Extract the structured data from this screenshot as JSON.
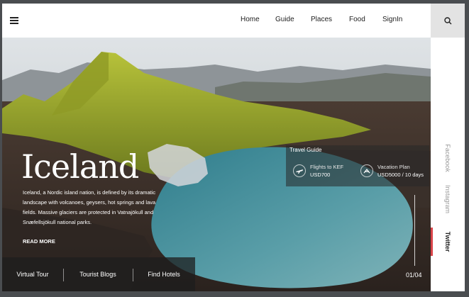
{
  "header": {
    "nav": [
      "Home",
      "Guide",
      "Places",
      "Food",
      "SignIn"
    ]
  },
  "icons": {
    "menu": "hamburger-icon",
    "search": "search-icon",
    "flight": "airplane-icon",
    "vacation": "beach-chair-icon"
  },
  "hero": {
    "title": "Iceland",
    "description": "Iceland, a Nordic island nation, is defined by its dramatic landscape with volcanoes, geysers, hot springs and lava fields. Massive glaciers are protected in Vatnajökull and Snæfellsjökull national parks.",
    "read_more": "READ MORE",
    "counter": "01/04"
  },
  "bottom_links": [
    "Virtual Tour",
    "Tourist Blogs",
    "Find Hotels"
  ],
  "travel_guide": {
    "title": "Travel Guide",
    "options": [
      {
        "label": "Flights to KEF",
        "value": "USD700"
      },
      {
        "label": "Vacation Plan",
        "value": "USD5000 / 10 days"
      }
    ]
  },
  "social": [
    "Facebook",
    "Instagram",
    "Twitter"
  ],
  "colors": {
    "accent": "#d9454a",
    "header_bg": "#ffffff",
    "search_bg": "#e3e3e3"
  }
}
